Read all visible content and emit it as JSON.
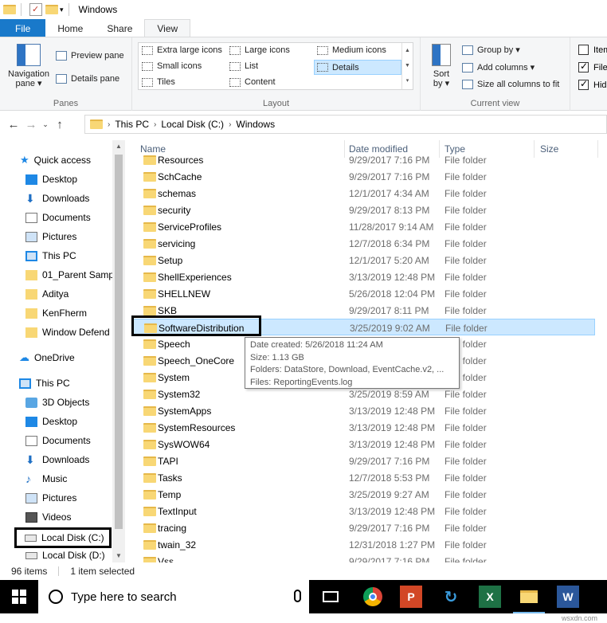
{
  "window": {
    "title": "Windows"
  },
  "ribbon_tabs": [
    "File",
    "Home",
    "Share",
    "View"
  ],
  "ribbon": {
    "panes": {
      "label": "Panes",
      "navigation_pane": "Navigation\npane ▾",
      "preview_pane": "Preview pane",
      "details_pane": "Details pane"
    },
    "layout": {
      "label": "Layout",
      "items": [
        "Extra large icons",
        "Large icons",
        "Medium icons",
        "Small icons",
        "List",
        "Details",
        "Tiles",
        "Content"
      ],
      "selected": "Details"
    },
    "current_view": {
      "label": "Current view",
      "sort_by": "Sort\nby ▾",
      "group_by": "Group by ▾",
      "add_columns": "Add columns ▾",
      "size_all": "Size all columns to fit"
    },
    "show_hide": {
      "item1": "Item",
      "item2": "File",
      "item3": "Hid"
    }
  },
  "address": {
    "crumbs": [
      "This PC",
      "Local Disk (C:)",
      "Windows"
    ]
  },
  "nav_pane": {
    "quick_access": "Quick access",
    "quick_items": [
      {
        "label": "Desktop",
        "pinned": true
      },
      {
        "label": "Downloads",
        "pinned": true
      },
      {
        "label": "Documents",
        "pinned": true
      },
      {
        "label": "Pictures",
        "pinned": true
      },
      {
        "label": "This PC",
        "pinned": true
      },
      {
        "label": "01_Parent Sampl",
        "pinned": false
      },
      {
        "label": "Aditya",
        "pinned": false
      },
      {
        "label": "KenFherm",
        "pinned": false
      },
      {
        "label": "Window Defend",
        "pinned": false
      }
    ],
    "onedrive": "OneDrive",
    "this_pc": "This PC",
    "pc_items": [
      "3D Objects",
      "Desktop",
      "Documents",
      "Downloads",
      "Music",
      "Pictures",
      "Videos",
      "Local Disk (C:)",
      "Local Disk (D:)"
    ]
  },
  "columns": {
    "name": "Name",
    "date": "Date modified",
    "type": "Type",
    "size": "Size"
  },
  "files": [
    {
      "name": "Resources",
      "date": "9/29/2017 7:16 PM",
      "type": "File folder"
    },
    {
      "name": "SchCache",
      "date": "9/29/2017 7:16 PM",
      "type": "File folder"
    },
    {
      "name": "schemas",
      "date": "12/1/2017 4:34 AM",
      "type": "File folder"
    },
    {
      "name": "security",
      "date": "9/29/2017 8:13 PM",
      "type": "File folder"
    },
    {
      "name": "ServiceProfiles",
      "date": "11/28/2017 9:14 AM",
      "type": "File folder"
    },
    {
      "name": "servicing",
      "date": "12/7/2018 6:34 PM",
      "type": "File folder"
    },
    {
      "name": "Setup",
      "date": "12/1/2017 5:20 AM",
      "type": "File folder"
    },
    {
      "name": "ShellExperiences",
      "date": "3/13/2019 12:48 PM",
      "type": "File folder"
    },
    {
      "name": "SHELLNEW",
      "date": "5/26/2018 12:04 PM",
      "type": "File folder"
    },
    {
      "name": "SKB",
      "date": "9/29/2017 8:11 PM",
      "type": "File folder"
    },
    {
      "name": "SoftwareDistribution",
      "date": "3/25/2019 9:02 AM",
      "type": "File folder"
    },
    {
      "name": "Speech",
      "date": "",
      "type": "File folder"
    },
    {
      "name": "Speech_OneCore",
      "date": "",
      "type": "File folder"
    },
    {
      "name": "System",
      "date": "",
      "type": "File folder"
    },
    {
      "name": "System32",
      "date": "3/25/2019 8:59 AM",
      "type": "File folder"
    },
    {
      "name": "SystemApps",
      "date": "3/13/2019 12:48 PM",
      "type": "File folder"
    },
    {
      "name": "SystemResources",
      "date": "3/13/2019 12:48 PM",
      "type": "File folder"
    },
    {
      "name": "SysWOW64",
      "date": "3/13/2019 12:48 PM",
      "type": "File folder"
    },
    {
      "name": "TAPI",
      "date": "9/29/2017 7:16 PM",
      "type": "File folder"
    },
    {
      "name": "Tasks",
      "date": "12/7/2018 5:53 PM",
      "type": "File folder"
    },
    {
      "name": "Temp",
      "date": "3/25/2019 9:27 AM",
      "type": "File folder"
    },
    {
      "name": "TextInput",
      "date": "3/13/2019 12:48 PM",
      "type": "File folder"
    },
    {
      "name": "tracing",
      "date": "9/29/2017 7:16 PM",
      "type": "File folder"
    },
    {
      "name": "twain_32",
      "date": "12/31/2018 1:27 PM",
      "type": "File folder"
    },
    {
      "name": "Vss",
      "date": "9/29/2017 7:16 PM",
      "type": "File folder"
    }
  ],
  "selected_file": "SoftwareDistribution",
  "tooltip": {
    "created": "Date created: 5/26/2018 11:24 AM",
    "size": "Size: 1.13 GB",
    "folders": "Folders: DataStore, Download, EventCache.v2, ...",
    "files": "Files: ReportingEvents.log"
  },
  "status": {
    "count": "96 items",
    "selected": "1 item selected"
  },
  "taskbar": {
    "search_placeholder": "Type here to search"
  },
  "watermark": "wsxdn.com",
  "colors": {
    "file_tab": "#1979ca",
    "selection": "#cce8ff",
    "folder": "#f8d775"
  }
}
